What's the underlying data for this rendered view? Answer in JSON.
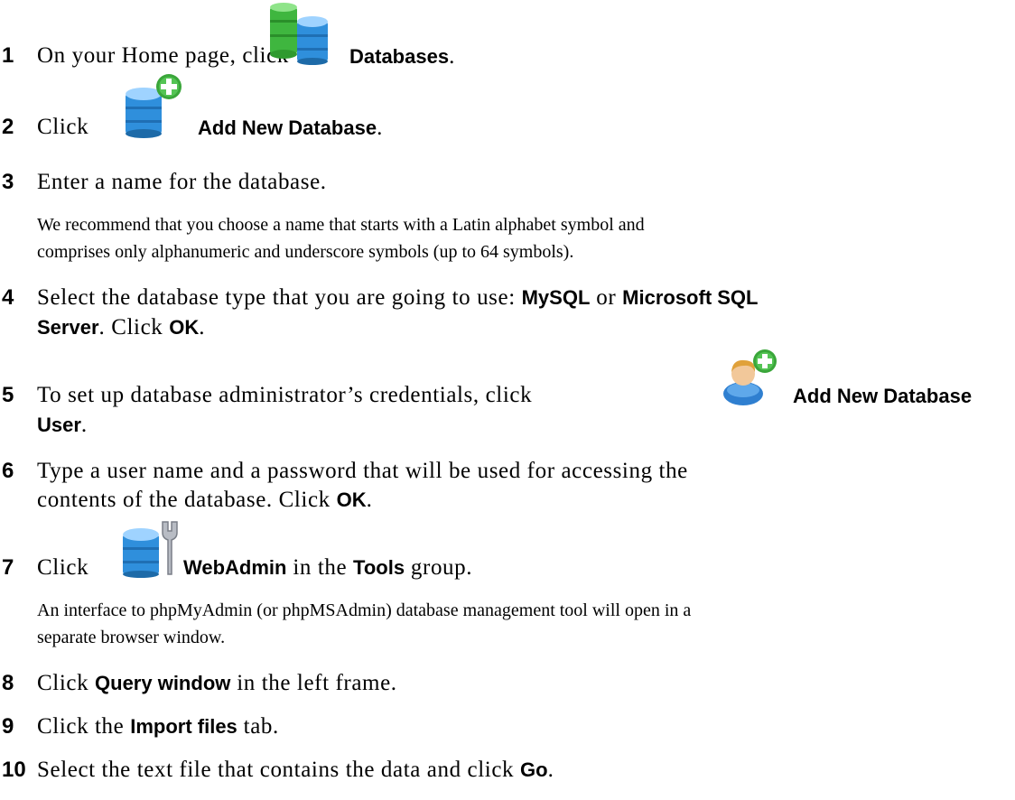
{
  "steps": [
    {
      "num": "1",
      "pre": "On your Home page, click",
      "bold": "Databases",
      "post": ".",
      "icon": "databases-icon"
    },
    {
      "num": "2",
      "pre": "Click",
      "bold": "Add New Database",
      "post": ".",
      "icon": "add-database-icon"
    },
    {
      "num": "3",
      "text": "Enter a name for the database.",
      "note": [
        "We recommend that you choose a name that starts with a Latin alphabet symbol and",
        "comprises only alphanumeric and underscore symbols (up to 64 symbols)."
      ]
    },
    {
      "num": "4",
      "line1_pre": "Select the database type that you are going to use: ",
      "line1_b1": "MySQL",
      "line1_mid": " or ",
      "line1_b2": "Microsoft SQL",
      "line2_b": "Server",
      "line2_mid": ". Click ",
      "line2_b2": "OK",
      "line2_post": "."
    },
    {
      "num": "5",
      "pre": "To set up database administrator’s credentials, click",
      "bold": "Add New Database",
      "line2_b": "User",
      "line2_post": ".",
      "icon": "add-user-icon"
    },
    {
      "num": "6",
      "line1": "Type a user name and a password that will be used for accessing the",
      "line2_pre": "contents of the database. Click ",
      "line2_b": "OK",
      "line2_post": "."
    },
    {
      "num": "7",
      "pre": "Click",
      "bold": "WebAdmin",
      "mid": " in the ",
      "bold2": "Tools",
      "post": " group.",
      "icon": "webadmin-icon",
      "note": [
        "An interface to phpMyAdmin (or phpMSAdmin) database management tool will open in a",
        "separate browser window."
      ]
    },
    {
      "num": "8",
      "pre": "Click ",
      "bold": "Query window",
      "post": " in the left frame."
    },
    {
      "num": "9",
      "pre": "Click the ",
      "bold": "Import files",
      "post": " tab."
    },
    {
      "num": "10",
      "pre": "Select the text file that contains the data and click ",
      "bold": "Go",
      "post": "."
    }
  ]
}
